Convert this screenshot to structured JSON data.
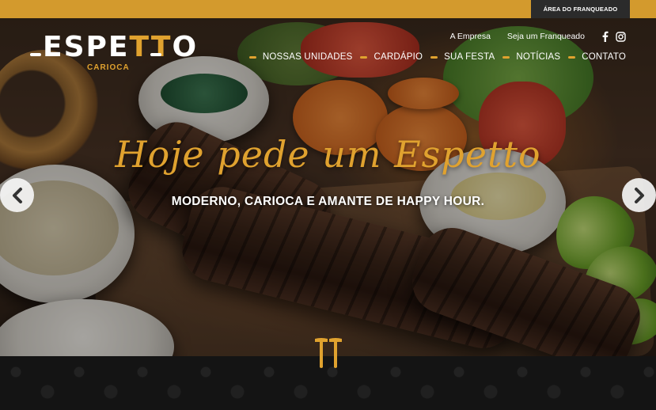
{
  "topbar": {
    "franchise_area_label": "ÁREA DO FRANQUEADO"
  },
  "brand": {
    "logo_text": "ESPETTO",
    "logo_subtext": "CARIOCA",
    "accent_color": "#e0a22f",
    "topbar_color": "#d39a2d"
  },
  "util_nav": {
    "items": [
      {
        "label": "A Empresa"
      },
      {
        "label": "Seja um Franqueado"
      }
    ],
    "social": [
      "facebook-icon",
      "instagram-icon"
    ]
  },
  "main_nav": {
    "items": [
      {
        "label": "NOSSAS UNIDADES"
      },
      {
        "label": "CARDÁPIO"
      },
      {
        "label": "SUA FESTA"
      },
      {
        "label": "NOTÍCIAS"
      },
      {
        "label": "CONTATO"
      }
    ]
  },
  "hero": {
    "headline": "Hoje pede um Espetto",
    "subheadline": "MODERNO, CARIOCA E AMANTE DE HAPPY HOUR."
  },
  "slider": {
    "prev_icon": "chevron-left-icon",
    "next_icon": "chevron-right-icon"
  }
}
